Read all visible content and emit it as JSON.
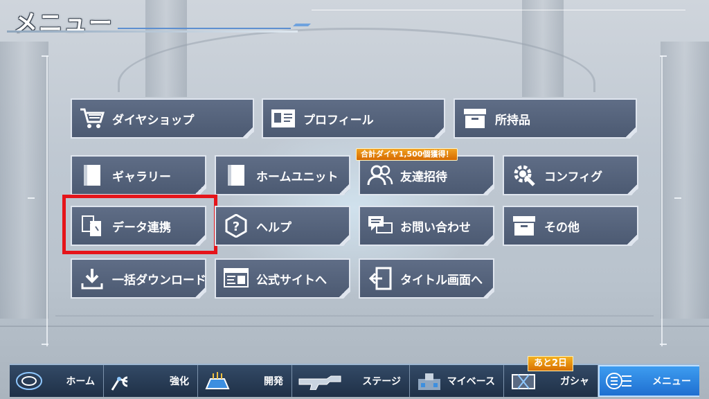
{
  "header": {
    "title": "メニュー"
  },
  "menu": {
    "diamond_shop": "ダイヤショップ",
    "profile": "プロフィール",
    "inventory": "所持品",
    "gallery": "ギャラリー",
    "home_unit": "ホームユニット",
    "invite_friends": "友達招待",
    "invite_badge": "合計ダイヤ1,500個獲得！",
    "config": "コンフィグ",
    "data_link": "データ連携",
    "help": "ヘルプ",
    "contact": "お問い合わせ",
    "other": "その他",
    "bulk_download": "一括ダウンロード",
    "official_site": "公式サイトへ",
    "to_title": "タイトル画面へ"
  },
  "nav": {
    "home": "ホーム",
    "enhance": "強化",
    "develop": "開発",
    "stage": "ステージ",
    "my_base": "マイベース",
    "gacha": "ガシャ",
    "gacha_badge": "あと2日",
    "menu": "メニュー"
  },
  "colors": {
    "highlight": "#e5141a",
    "button_bg": "#56637b",
    "badge": "#e58a10",
    "active_nav": "#2f86e6"
  }
}
